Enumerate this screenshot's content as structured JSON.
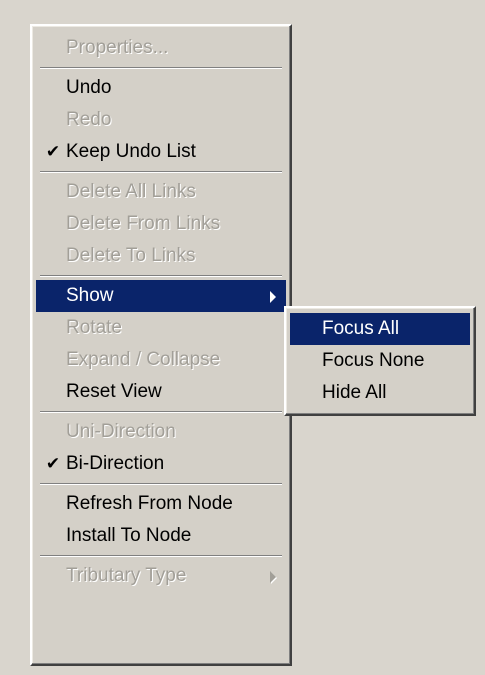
{
  "context_menu": {
    "items": {
      "properties": {
        "label": "Properties..."
      },
      "undo": {
        "label": "Undo"
      },
      "redo": {
        "label": "Redo"
      },
      "keep_undo_list": {
        "label": "Keep Undo List",
        "check": "✔"
      },
      "delete_all_links": {
        "label": "Delete All Links"
      },
      "delete_from_links": {
        "label": "Delete From Links"
      },
      "delete_to_links": {
        "label": "Delete To Links"
      },
      "show": {
        "label": "Show"
      },
      "rotate": {
        "label": "Rotate"
      },
      "expand_collapse": {
        "label": "Expand / Collapse"
      },
      "reset_view": {
        "label": "Reset View"
      },
      "uni_direction": {
        "label": "Uni-Direction"
      },
      "bi_direction": {
        "label": "Bi-Direction",
        "check": "✔"
      },
      "refresh_from_node": {
        "label": "Refresh From Node"
      },
      "install_to_node": {
        "label": "Install To Node"
      },
      "tributary_type": {
        "label": "Tributary Type"
      }
    }
  },
  "show_submenu": {
    "items": {
      "focus_all": {
        "label": "Focus All"
      },
      "focus_none": {
        "label": "Focus None"
      },
      "hide_all": {
        "label": "Hide All"
      }
    }
  },
  "colors": {
    "menu_background": "#d4d0c8",
    "highlight": "#0a246a",
    "disabled_text": "#a29f98"
  }
}
